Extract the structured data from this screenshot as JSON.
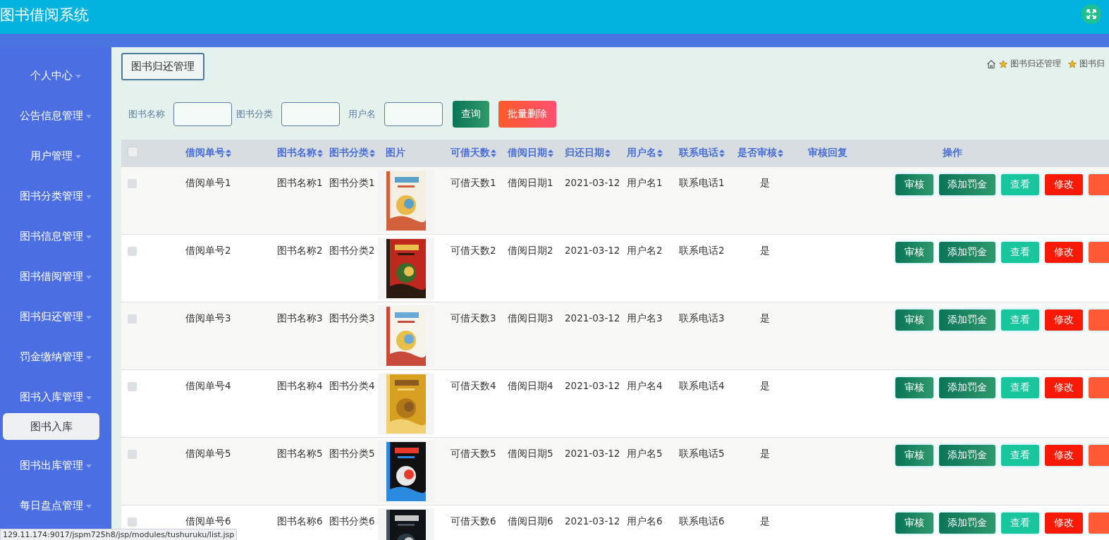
{
  "app": {
    "title": "图书借阅系统"
  },
  "sidebar": {
    "items": [
      {
        "label": "个人中心"
      },
      {
        "label": "公告信息管理"
      },
      {
        "label": "用户管理"
      },
      {
        "label": "图书分类管理"
      },
      {
        "label": "图书信息管理"
      },
      {
        "label": "图书借阅管理"
      },
      {
        "label": "图书归还管理"
      },
      {
        "label": "罚金缴纳管理"
      },
      {
        "label": "图书入库管理",
        "children": [
          {
            "label": "图书入库",
            "selected": true
          }
        ]
      },
      {
        "label": "图书出库管理"
      },
      {
        "label": "每日盘点管理"
      }
    ]
  },
  "page": {
    "tab": "图书归还管理",
    "breadcrumb": [
      "图书归还管理",
      "图书归"
    ]
  },
  "search": {
    "fields": [
      {
        "label": "图书名称"
      },
      {
        "label": "图书分类"
      },
      {
        "label": "用户名"
      }
    ],
    "buttons": [
      {
        "label": "查询",
        "kind": "query"
      },
      {
        "label": "批量删除",
        "kind": "delete"
      }
    ]
  },
  "table": {
    "select_all": {
      "checked": false
    },
    "columns": [
      {
        "label": "借阅单号",
        "sortable": true
      },
      {
        "label": "图书名称",
        "sortable": true
      },
      {
        "label": "图书分类",
        "sortable": true
      },
      {
        "label": "图片",
        "sortable": false
      },
      {
        "label": "可借天数",
        "sortable": true
      },
      {
        "label": "借阅日期",
        "sortable": true
      },
      {
        "label": "归还日期",
        "sortable": true
      },
      {
        "label": "用户名",
        "sortable": true
      },
      {
        "label": "联系电话",
        "sortable": true
      },
      {
        "label": "是否审核",
        "sortable": true
      },
      {
        "label": "审核回复",
        "sortable": false
      },
      {
        "label": "操作",
        "sortable": false
      }
    ],
    "rows": [
      {
        "checked": false,
        "cells": [
          "借阅单号1",
          "图书名称1",
          "图书分类1",
          {
            "kind": "picture"
          },
          "可借天数1",
          "借阅日期1",
          "2021-03-12",
          "用户名1",
          "联系电话1",
          "是"
        ],
        "actions": [
          {
            "label": "审核",
            "kind": "review"
          },
          {
            "label": "添加罚金",
            "kind": "fine"
          },
          {
            "label": "查看",
            "kind": "view"
          },
          {
            "label": "修改",
            "kind": "edit"
          },
          {
            "kind": "delete"
          }
        ]
      },
      {
        "checked": false,
        "cells": [
          "借阅单号2",
          "图书名称2",
          "图书分类2",
          {
            "kind": "picture"
          },
          "可借天数2",
          "借阅日期2",
          "2021-03-12",
          "用户名2",
          "联系电话2",
          "是"
        ],
        "actions": [
          {
            "label": "审核",
            "kind": "review"
          },
          {
            "label": "添加罚金",
            "kind": "fine"
          },
          {
            "label": "查看",
            "kind": "view"
          },
          {
            "label": "修改",
            "kind": "edit"
          },
          {
            "kind": "delete"
          }
        ]
      },
      {
        "checked": false,
        "cells": [
          "借阅单号3",
          "图书名称3",
          "图书分类3",
          {
            "kind": "picture"
          },
          "可借天数3",
          "借阅日期3",
          "2021-03-12",
          "用户名3",
          "联系电话3",
          "是"
        ],
        "actions": [
          {
            "label": "审核",
            "kind": "review"
          },
          {
            "label": "添加罚金",
            "kind": "fine"
          },
          {
            "label": "查看",
            "kind": "view"
          },
          {
            "label": "修改",
            "kind": "edit"
          },
          {
            "kind": "delete"
          }
        ]
      },
      {
        "checked": false,
        "cells": [
          "借阅单号4",
          "图书名称4",
          "图书分类4",
          {
            "kind": "picture"
          },
          "可借天数4",
          "借阅日期4",
          "2021-03-12",
          "用户名4",
          "联系电话4",
          "是"
        ],
        "actions": [
          {
            "label": "审核",
            "kind": "review"
          },
          {
            "label": "添加罚金",
            "kind": "fine"
          },
          {
            "label": "查看",
            "kind": "view"
          },
          {
            "label": "修改",
            "kind": "edit"
          },
          {
            "kind": "delete"
          }
        ]
      },
      {
        "checked": false,
        "cells": [
          "借阅单号5",
          "图书名称5",
          "图书分类5",
          {
            "kind": "picture"
          },
          "可借天数5",
          "借阅日期5",
          "2021-03-12",
          "用户名5",
          "联系电话5",
          "是"
        ],
        "actions": [
          {
            "label": "审核",
            "kind": "review"
          },
          {
            "label": "添加罚金",
            "kind": "fine"
          },
          {
            "label": "查看",
            "kind": "view"
          },
          {
            "label": "修改",
            "kind": "edit"
          },
          {
            "kind": "delete"
          }
        ]
      },
      {
        "checked": false,
        "cells": [
          "借阅单号6",
          "图书名称6",
          "图书分类6",
          {
            "kind": "picture"
          },
          "可借天数6",
          "借阅日期6",
          "2021-03-12",
          "用户名6",
          "联系电话6",
          "是"
        ],
        "actions": [
          {
            "label": "审核",
            "kind": "review"
          },
          {
            "label": "添加罚金",
            "kind": "fine"
          },
          {
            "label": "查看",
            "kind": "view"
          },
          {
            "label": "修改",
            "kind": "edit"
          },
          {
            "kind": "delete"
          }
        ]
      }
    ]
  },
  "status_bar": {
    "url": "129.11.174:9017/jspm725h8/jsp/modules/tushuruku/list.jsp"
  }
}
